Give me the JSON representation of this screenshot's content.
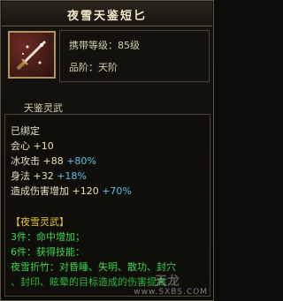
{
  "item": {
    "name": "夜雪天鉴短匕",
    "carry_level": "携带等级：85级",
    "grade": "品阶：天阶",
    "sub_type": "天鉴灵武"
  },
  "stats": {
    "bound": "已绑定",
    "lines": [
      {
        "name": "会心",
        "base": "+10",
        "bonus": ""
      },
      {
        "name": "冰攻击",
        "base": "+88",
        "bonus": "+80%"
      },
      {
        "name": "身法",
        "base": "+32",
        "bonus": "+18%"
      },
      {
        "name": "造成伤害增加",
        "base": "+120",
        "bonus": "+70%"
      }
    ]
  },
  "set": {
    "title": "【夜雪灵武】",
    "piece3": "3件：命中增加；",
    "piece6": "6件：获得技能：",
    "skill_line1": "夜雪折竹：对昏睡、失明、散功、封穴",
    "skill_line2": "、封印、眩晕的目标造成的伤害提高"
  },
  "watermark": {
    "url": "www.SXBS.COM",
    "logo": "天龙"
  },
  "colors": {
    "title": "#f2e8c7",
    "stat_bonus": "#5bc0e8",
    "set_title": "#e5c23a",
    "set_text": "#3fd84a"
  },
  "icons": {
    "item_icon": "dagger-icon"
  }
}
